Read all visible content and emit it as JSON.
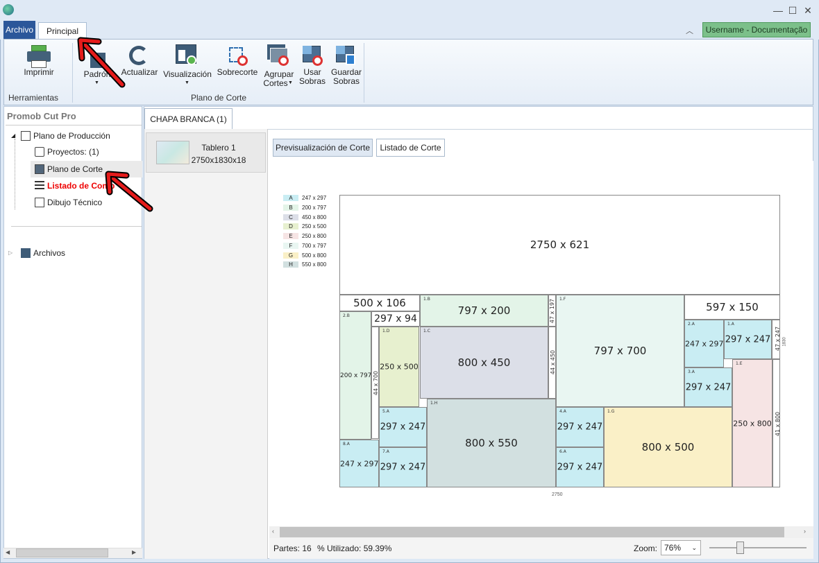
{
  "titlebar": {
    "min": "—",
    "max": "☐",
    "close": "✕"
  },
  "tabs": {
    "archivo": "Archivo",
    "principal": "Principal"
  },
  "user": "Username - Documentação",
  "ribbon": {
    "imprimir": "Imprimir",
    "herramientas": "Herramientas",
    "padron": "Padrón",
    "actualizar": "Actualizar",
    "visualizacion": "Visualización",
    "sobrecorte": "Sobrecorte",
    "agrupar1": "Agrupar",
    "agrupar2": "Cortes",
    "usar1": "Usar",
    "usar2": "Sobras",
    "guardar1": "Guardar",
    "guardar2": "Sobras",
    "plano_group": "Plano de Corte"
  },
  "left": {
    "title": "Promob Cut Pro",
    "plano_produccion": "Plano de Producción",
    "proyectos": "Proyectos: (1)",
    "plano_corte": "Plano de Corte",
    "listado": "Listado de Comp",
    "dibujo": "Dibujo Técnico",
    "archivos": "Archivos"
  },
  "doc_tab": "CHAPA BRANCA (1)",
  "board": {
    "name": "Tablero 1",
    "dims": "2750x1830x18"
  },
  "subtabs": {
    "preview": "Previsualización de Corte",
    "listado": "Listado de Corte"
  },
  "legend": [
    {
      "key": "A",
      "size": "247 x 297",
      "color": "#c9edf3"
    },
    {
      "key": "B",
      "size": "200 x 797",
      "color": "#e3f4e8"
    },
    {
      "key": "C",
      "size": "450 x 800",
      "color": "#dcdfe8"
    },
    {
      "key": "D",
      "size": "250 x 500",
      "color": "#e7f0cf"
    },
    {
      "key": "E",
      "size": "250 x 800",
      "color": "#f6e4e4"
    },
    {
      "key": "F",
      "size": "700 x 797",
      "color": "#e9f6f2"
    },
    {
      "key": "G",
      "size": "500 x 800",
      "color": "#faf0c7"
    },
    {
      "key": "H",
      "size": "550 x 800",
      "color": "#d2e0e0"
    }
  ],
  "pieces": {
    "top": "2750 x 621",
    "s500": "500 x 106",
    "s297": "297 x 94",
    "b1": "797 x 200",
    "b1id": "1.B",
    "v47a": "47 x 197",
    "f1": "797 x 700",
    "f1id": "1.F",
    "s597": "597 x 150",
    "b2": "200 x 797",
    "b2id": "2.B",
    "d1": "250 x 500",
    "d1id": "1.D",
    "v44a": "44 x 700",
    "c1": "800 x 450",
    "c1id": "1.C",
    "v44b": "44 x 450",
    "a2": "247 x 297",
    "a2id": "2.A",
    "a1": "297 x 247",
    "a1id": "1.A",
    "v47b": "47 x 247",
    "a3": "297 x 247",
    "a3id": "3.A",
    "e1": "250 x 800",
    "e1id": "1.E",
    "v41": "41 x 800",
    "a5": "297 x 247",
    "a5id": "5.A",
    "h1": "800 x 550",
    "h1id": "1.H",
    "a4": "297 x 247",
    "a4id": "4.A",
    "g1": "800 x 500",
    "g1id": "1.G",
    "a8": "247 x 297",
    "a8id": "8.A",
    "a7": "297 x 247",
    "a7id": "7.A",
    "a6": "297 x 247",
    "a6id": "6.A",
    "bottom_dim": "2750",
    "side_dim": "1830"
  },
  "status": {
    "partes": "Partes: 16",
    "utilizado": "% Utilizado: 59.39%",
    "zoom_label": "Zoom:",
    "zoom_value": "76%"
  }
}
